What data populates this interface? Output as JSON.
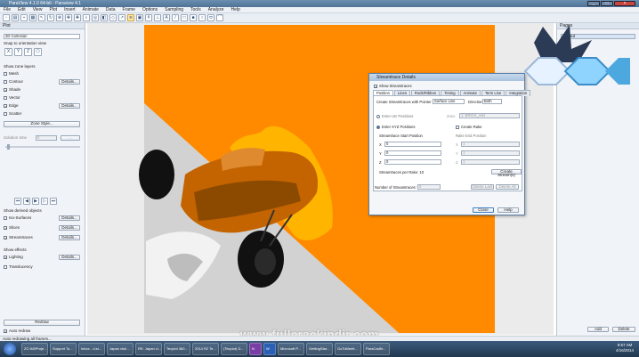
{
  "window": {
    "title": "ParaView 4.1.0 64-bit - Paraview 4.1"
  },
  "menu": [
    "File",
    "Edit",
    "View",
    "Plot",
    "Insert",
    "Animate",
    "Data",
    "Frame",
    "Options",
    "Sampling",
    "Tools",
    "Analyze",
    "Help"
  ],
  "left_panel": {
    "header": "Plot",
    "dropdown": "3D Cartesian",
    "snap_label": "Snap to orientation view",
    "zone_layers_label": "Show zone layers",
    "layers": [
      {
        "label": "Mesh",
        "checked": false
      },
      {
        "label": "Contour",
        "checked": false,
        "details": "Details..."
      },
      {
        "label": "Shade",
        "checked": true
      },
      {
        "label": "Vector",
        "checked": false
      },
      {
        "label": "Edge",
        "checked": true,
        "details": "Details..."
      },
      {
        "label": "Scatter",
        "checked": false
      }
    ],
    "zone_style": "Zone Style...",
    "solution_time_label": "Solution time",
    "solution_time_value": "0",
    "derived_label": "Show derived objects",
    "derived": [
      {
        "label": "Iso-Surfaces",
        "checked": false,
        "details": "Details..."
      },
      {
        "label": "Slices",
        "checked": true,
        "details": "Details..."
      },
      {
        "label": "Streamtraces",
        "checked": true,
        "details": "Details..."
      }
    ],
    "effects_label": "Show effects",
    "effects": [
      {
        "label": "Lighting",
        "checked": true,
        "details": "Details..."
      },
      {
        "label": "Translucency",
        "checked": false
      }
    ],
    "redraw": "Redraw",
    "auto_redraw": "Auto redraw"
  },
  "right_panel": {
    "header": "Pages",
    "item": "Untitled",
    "add": "Add",
    "delete": "Delete"
  },
  "dialog": {
    "title": "Streamtrace Details",
    "show_label": "Show Streamtraces",
    "tabs": [
      "Position",
      "Lines",
      "Rods/Ribbon",
      "Timing",
      "Animate",
      "Term Line",
      "Integration"
    ],
    "create_label": "Create Streamtraces with Pointer",
    "create_value": "Surface Line",
    "direction_label": "Direction",
    "direction_value": "Both",
    "enter_ijk": "Enter IJK Positions",
    "zone_label": "Zone",
    "zone_value": "1: BRICK_vols",
    "enter_xyz": "Enter XYZ Positions",
    "create_rake": "Create Rake",
    "start_label": "Streamtrace Start Position",
    "end_label": "Rake End Position",
    "xyz": [
      {
        "axis": "X",
        "value": "0"
      },
      {
        "axis": "Y",
        "value": "0"
      },
      {
        "axis": "Z",
        "value": "0"
      }
    ],
    "end_xyz": [
      {
        "axis": "X",
        "value": "1"
      },
      {
        "axis": "Y",
        "value": "1"
      },
      {
        "axis": "Z",
        "value": "1"
      }
    ],
    "per_rake": "Streamtraces per Rake: 10",
    "create_btn": "Create Stream(s)",
    "number_label": "Number of Streamtraces:",
    "number_value": "0",
    "delete_last": "Delete Last",
    "delete_all": "Delete All",
    "close": "Close",
    "help": "Help"
  },
  "status": "Auto redrawing all frames...",
  "watermark": "www.fullcrackindir.com",
  "taskbar": {
    "items": [
      "ZC:\\Ml\\Proje...",
      "Support To...",
      "Inbox - d.st...",
      "Japan visit ...",
      "RE: Japan vi...",
      "Tecplot 360...",
      "2014 R2 Te...",
      "(Tecplot) D...",
      "N",
      "W",
      "Microsoft P...",
      "GettingStar...",
      "GoToMeeti...",
      "ParaCadfir..."
    ],
    "time": "9:57 AM",
    "date": "4/16/2014"
  },
  "colors": {
    "orange": "#ff8a00",
    "dark_orange": "#a84f00",
    "accent": "#35507a"
  }
}
